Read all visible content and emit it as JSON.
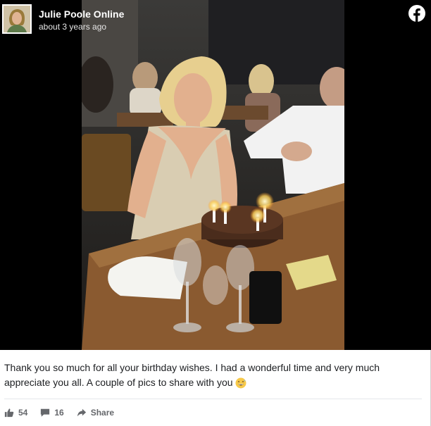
{
  "post": {
    "page_name": "Julie Poole Online",
    "timestamp": "about 3 years ago",
    "caption": "Thank you so much for all your birthday wishes. I had a wonderful time and very much appreciate you all. A couple of pics to share with you",
    "caption_emoji": "grinning-sweat-face",
    "brand_icon": "facebook-logo-icon",
    "brand_color": "#ffffff"
  },
  "actions": {
    "likes": "54",
    "comments": "16",
    "share_label": "Share"
  }
}
